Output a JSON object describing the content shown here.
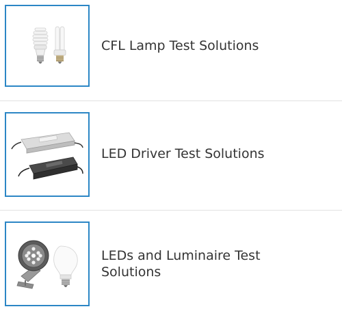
{
  "items": [
    {
      "label": "CFL Lamp Test Solutions",
      "image": "cfl-lamps-image"
    },
    {
      "label": "LED Driver Test Solutions",
      "image": "led-driver-image"
    },
    {
      "label": "LEDs and Luminaire Test Solutions",
      "image": "led-luminaire-image"
    }
  ],
  "colors": {
    "thumb_border": "#2b86c5",
    "divider": "#e1e1e1",
    "text": "#333333"
  }
}
